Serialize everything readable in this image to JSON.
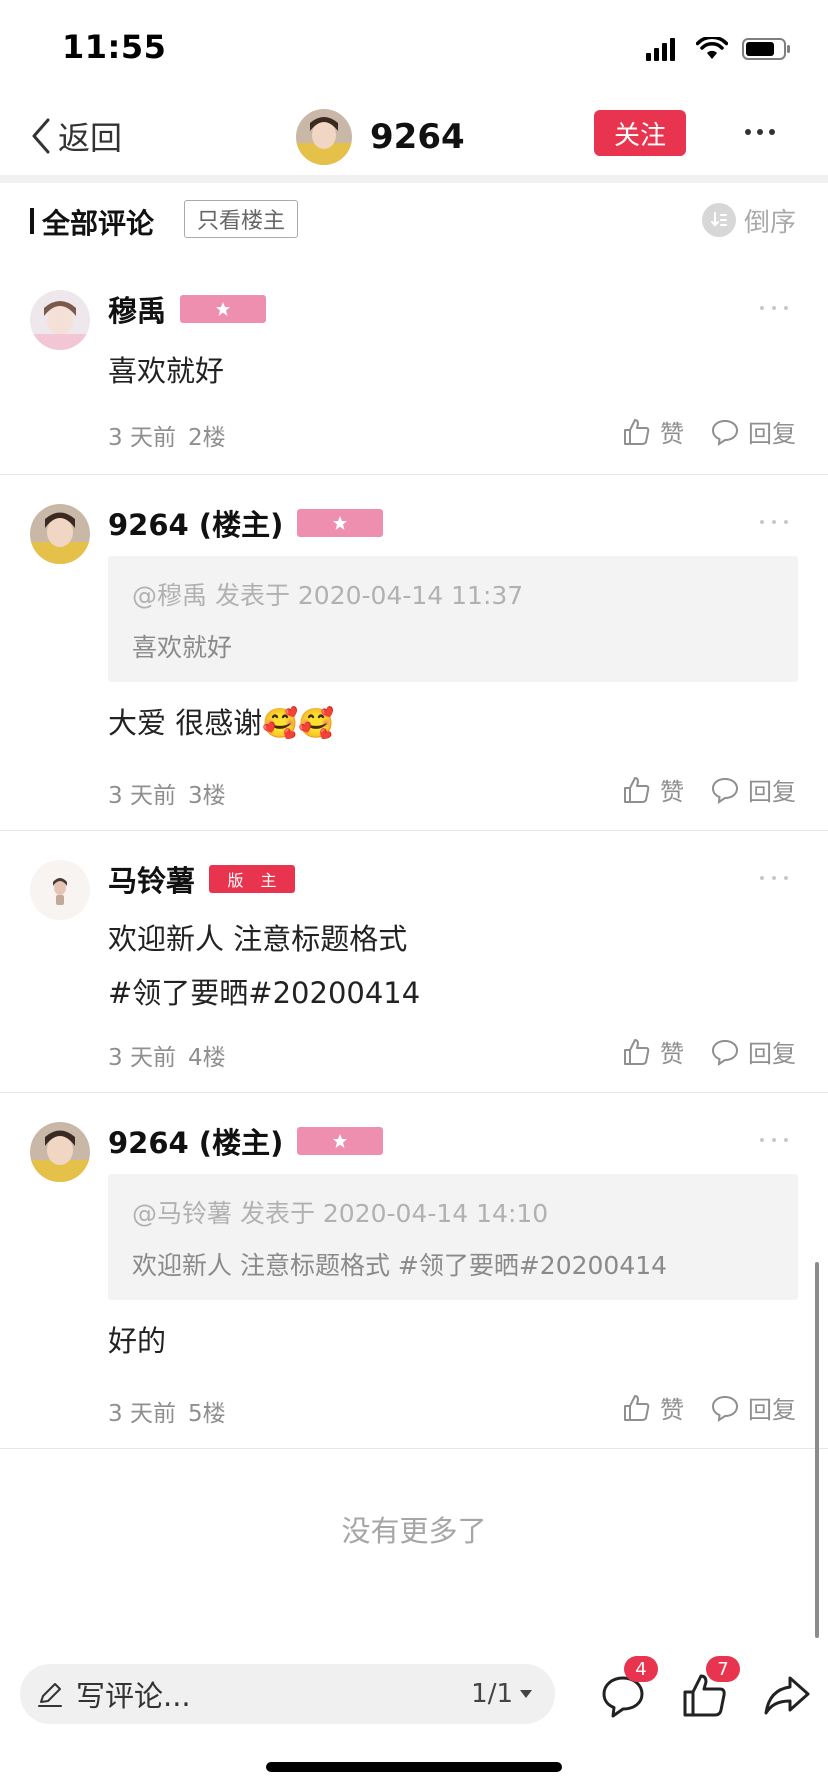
{
  "status_bar": {
    "time": "11:55"
  },
  "nav": {
    "back_label": "返回",
    "title_name": "9264",
    "follow_label": "关注"
  },
  "section": {
    "title": "全部评论",
    "filter_label": "只看楼主",
    "sort_label": "倒序"
  },
  "comments": [
    {
      "name": "穆禹",
      "badge": "star",
      "text": "喜欢就好",
      "time": "3 天前",
      "floor": "2楼",
      "like_label": "赞",
      "reply_label": "回复"
    },
    {
      "name": "9264 (楼主)",
      "badge": "star",
      "quote_meta": "@穆禹 发表于 2020-04-14 11:37",
      "quote_text": "喜欢就好",
      "text": "大爱  很感谢🥰🥰",
      "time": "3 天前",
      "floor": "3楼",
      "like_label": "赞",
      "reply_label": "回复"
    },
    {
      "name": "马铃薯",
      "badge_text": "版 主",
      "text_line1": "欢迎新人 注意标题格式",
      "text_line2": "#领了要晒#20200414",
      "time": "3 天前",
      "floor": "4楼",
      "like_label": "赞",
      "reply_label": "回复"
    },
    {
      "name": "9264 (楼主)",
      "badge": "star",
      "quote_meta": "@马铃薯 发表于 2020-04-14 14:10",
      "quote_text": "欢迎新人 注意标题格式 #领了要晒#20200414",
      "text": "好的",
      "time": "3 天前",
      "floor": "5楼",
      "like_label": "赞",
      "reply_label": "回复"
    }
  ],
  "no_more": "没有更多了",
  "bottom": {
    "comment_placeholder": "写评论...",
    "page_indicator": "1/1",
    "comment_count": "4",
    "like_count": "7"
  },
  "colors": {
    "accent_red": "#e8344e",
    "badge_pink": "#ef8fb0",
    "meta_gray": "#8f8f8f"
  },
  "icons": [
    "back-chevron-icon",
    "more-dots-icon",
    "sort-icon",
    "thumb-up-icon",
    "reply-bubble-icon",
    "pencil-icon",
    "comment-icon",
    "like-icon",
    "share-icon",
    "star-icon"
  ]
}
